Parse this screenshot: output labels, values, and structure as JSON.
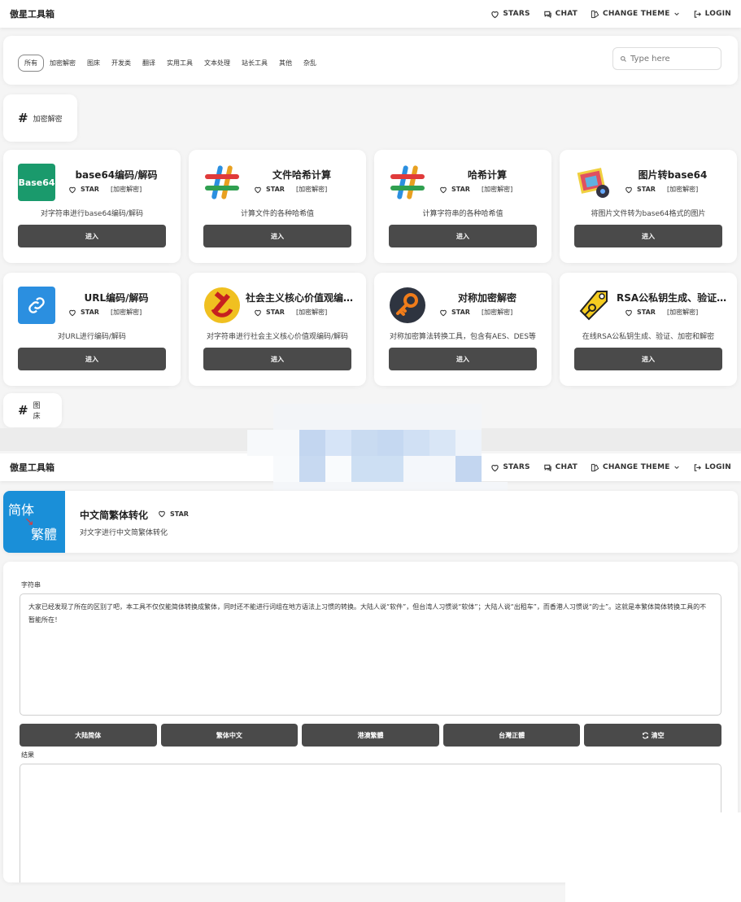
{
  "navbar": {
    "brand": "傲星工具箱",
    "stars": "STARS",
    "chat": "CHAT",
    "change_theme": "CHANGE THEME",
    "login": "LOGIN"
  },
  "filter": {
    "categories": [
      "所有",
      "加密解密",
      "图床",
      "开发类",
      "翻译",
      "实用工具",
      "文本处理",
      "站长工具",
      "其他",
      "杂乱"
    ],
    "search_placeholder": "Type here"
  },
  "sections": {
    "crypto": "加密解密",
    "image_host": "图床"
  },
  "tools": [
    {
      "name": "base64编码/解码",
      "star": "STAR",
      "tag": "[加密解密]",
      "desc": "对字符串进行base64编码/解码",
      "enter": "进入",
      "icon": "base64-icon",
      "icon_text": "Base64"
    },
    {
      "name": "文件哈希计算",
      "star": "STAR",
      "tag": "[加密解密]",
      "desc": "计算文件的各种哈希值",
      "enter": "进入",
      "icon": "hash-icon"
    },
    {
      "name": "哈希计算",
      "star": "STAR",
      "tag": "[加密解密]",
      "desc": "计算字符串的各种哈希值",
      "enter": "进入",
      "icon": "hash-icon"
    },
    {
      "name": "图片转base64",
      "star": "STAR",
      "tag": "[加密解密]",
      "desc": "将图片文件转为base64格式的图片",
      "enter": "进入",
      "icon": "image-icon"
    },
    {
      "name": "URL编码/解码",
      "star": "STAR",
      "tag": "[加密解密]",
      "desc": "对URL进行编码/解码",
      "enter": "进入",
      "icon": "link-icon"
    },
    {
      "name": "社会主义核心价值观编码/解码",
      "star": "STAR",
      "tag": "[加密解密]",
      "desc": "对字符串进行社会主义核心价值观编码/解码",
      "enter": "进入",
      "icon": "emblem-icon"
    },
    {
      "name": "对称加密解密",
      "star": "STAR",
      "tag": "[加密解密]",
      "desc": "对称加密算法转换工具，包含有AES、DES等",
      "enter": "进入",
      "icon": "key-icon"
    },
    {
      "name": "RSA公私钥生成、验证、加密解密",
      "star": "STAR",
      "tag": "[加密解密]",
      "desc": "在线RSA公私钥生成、验证、加密和解密",
      "enter": "进入",
      "icon": "tag-key-icon"
    }
  ],
  "detail": {
    "title": "中文简繁体转化",
    "star": "STAR",
    "desc": "对文字进行中文简繁体转化",
    "icon_text_top": "简体",
    "icon_text_bottom": "繁體",
    "input_label": "字符串",
    "input_value": "大家已经发现了所在的区别了吧，本工具不仅仅能简体转换成繁体，同时还不能进行词组在地方语法上习惯的转换。大陆人说“软件”，但台湾人习惯说“软体”；大陆人说“出租车”，而香港人习惯说“的士”。这就是本繁体简体转换工具的不暂能所在！",
    "buttons": [
      "大陆简体",
      "繁体中文",
      "港澳繁體",
      "台灣正體",
      "清空"
    ],
    "result_label": "结果",
    "result_value": ""
  },
  "colors": {
    "button_dark": "#4a4a4a",
    "detail_icon_bg": "#1a8fd8",
    "base64_green": "#1a9a6c",
    "link_blue": "#2b8fe0",
    "key_dark": "#2e3440",
    "key_orange": "#f07c1a"
  }
}
